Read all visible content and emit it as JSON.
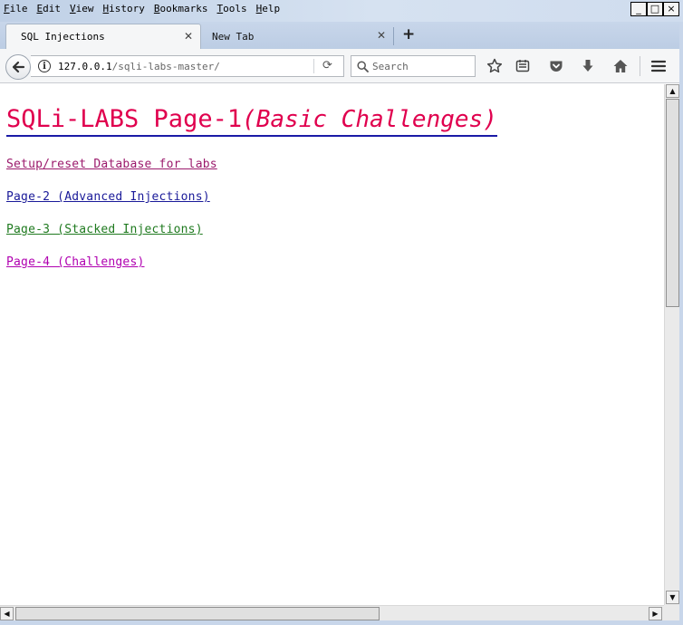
{
  "menubar": {
    "items": [
      "File",
      "Edit",
      "View",
      "History",
      "Bookmarks",
      "Tools",
      "Help"
    ]
  },
  "window_controls": {
    "minimize": "_",
    "maximize": "□",
    "close": "×"
  },
  "tabs": [
    {
      "label": "SQL Injections",
      "active": true
    },
    {
      "label": "New Tab",
      "active": false
    }
  ],
  "newtab": {
    "label": "+"
  },
  "urlbar": {
    "host": "127.0.0.1",
    "path": "/sqli-labs-master/"
  },
  "searchbar": {
    "placeholder": "Search"
  },
  "page": {
    "heading": "SQLi-LABS Page-1",
    "heading_sub": "(Basic Challenges)",
    "links": [
      {
        "text": "Setup/reset Database for labs",
        "color": "#9b1a6c"
      },
      {
        "text": "Page-2 (Advanced Injections)",
        "color": "#1a1a99"
      },
      {
        "text": "Page-3 (Stacked Injections)",
        "color": "#1f7a1f"
      },
      {
        "text": "Page-4 (Challenges)",
        "color": "#b000b0"
      }
    ]
  },
  "colors": {
    "heading": "#e0004e",
    "heading_underline": "#1a1aa6",
    "chrome": "#c8d6ea"
  }
}
